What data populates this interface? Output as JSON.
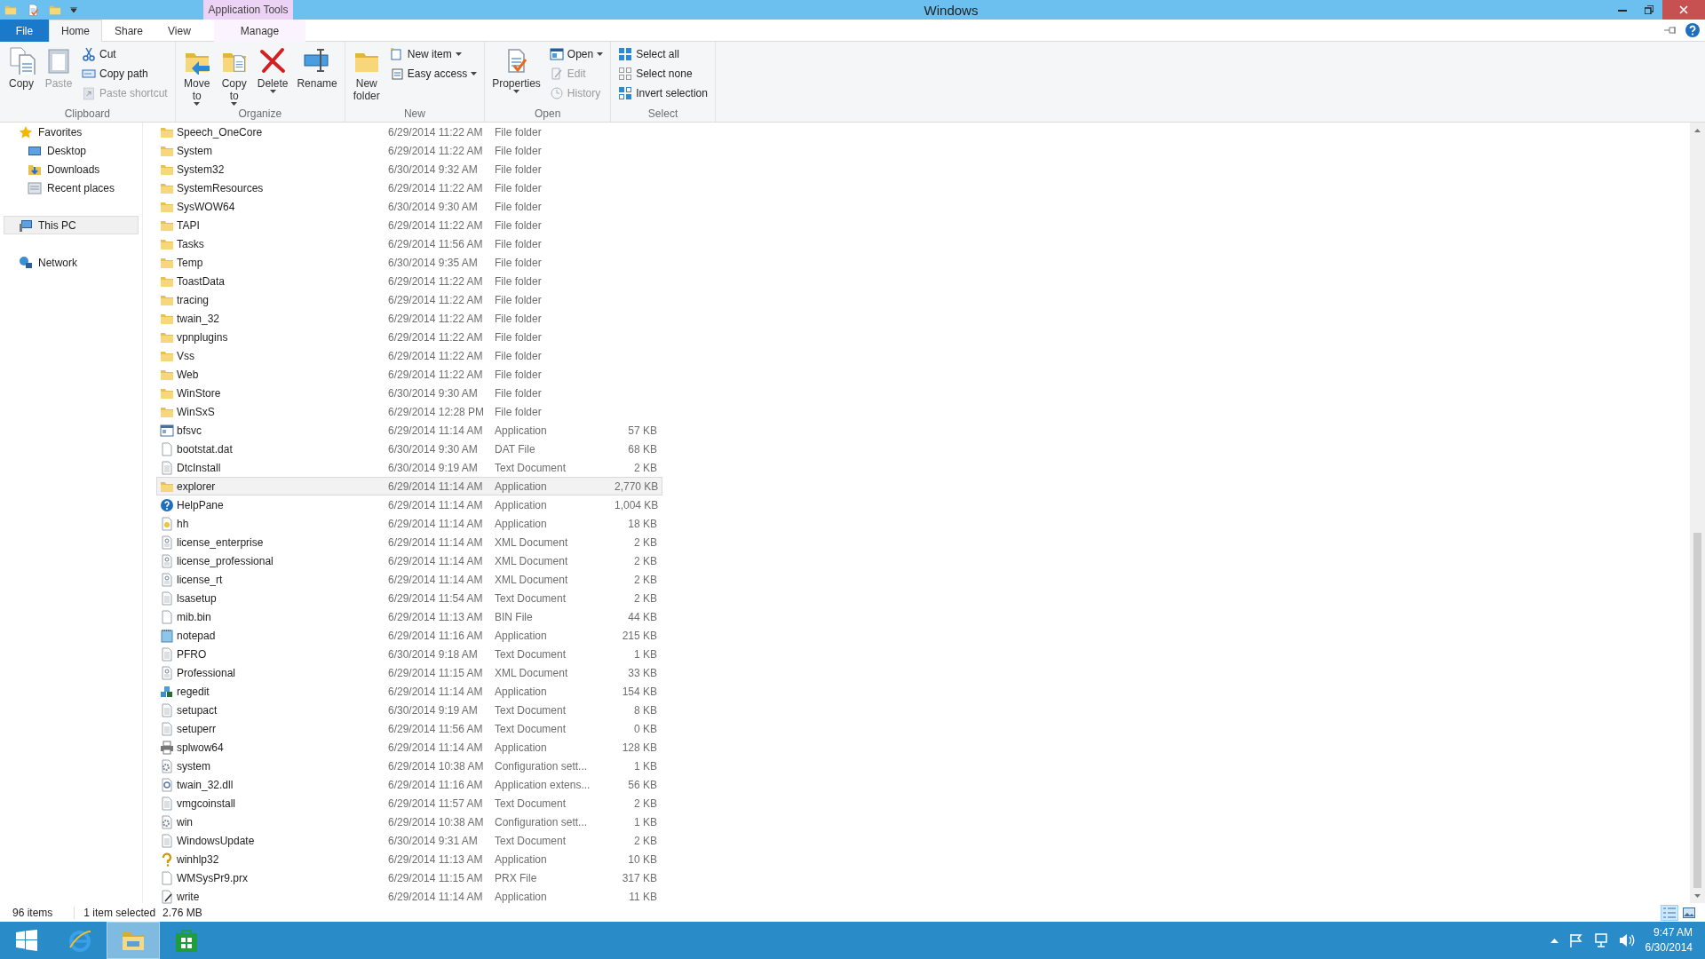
{
  "window": {
    "title": "Windows",
    "context_tab": "Application Tools"
  },
  "quick_access": [
    {
      "kind": "folder"
    },
    {
      "kind": "properties"
    },
    {
      "kind": "newfolder"
    },
    {
      "kind": "caret"
    }
  ],
  "tabs": [
    {
      "label": "File",
      "kind": "file",
      "selected": false
    },
    {
      "label": "Home",
      "kind": "tab",
      "selected": true
    },
    {
      "label": "Share",
      "kind": "tab",
      "selected": false
    },
    {
      "label": "View",
      "kind": "tab",
      "selected": false
    },
    {
      "label": "Manage",
      "kind": "context",
      "selected": false
    }
  ],
  "ribbon": [
    {
      "label": "Clipboard",
      "large_buttons": [
        {
          "lines": [
            "Copy"
          ],
          "kind": "copy",
          "disabled": false,
          "dropdown": false
        },
        {
          "lines": [
            "Paste"
          ],
          "kind": "paste",
          "disabled": true,
          "dropdown": false
        }
      ],
      "small_buttons": [
        {
          "label": "Cut",
          "kind": "cut",
          "disabled": false,
          "dropdown": false
        },
        {
          "label": "Copy path",
          "kind": "path",
          "disabled": false,
          "dropdown": false
        },
        {
          "label": "Paste shortcut",
          "kind": "shortcut",
          "disabled": true,
          "dropdown": false
        }
      ]
    },
    {
      "label": "Organize",
      "large_buttons": [
        {
          "lines": [
            "Move",
            "to"
          ],
          "kind": "move",
          "disabled": false,
          "dropdown": true
        },
        {
          "lines": [
            "Copy",
            "to"
          ],
          "kind": "copyto",
          "disabled": false,
          "dropdown": true
        },
        {
          "lines": [
            "Delete"
          ],
          "kind": "delete",
          "disabled": false,
          "dropdown": true
        },
        {
          "lines": [
            "Rename"
          ],
          "kind": "rename",
          "disabled": false,
          "dropdown": false
        }
      ]
    },
    {
      "label": "New",
      "large_buttons": [
        {
          "lines": [
            "New",
            "folder"
          ],
          "kind": "newfolder",
          "disabled": false,
          "dropdown": false
        }
      ],
      "small_buttons": [
        {
          "label": "New item",
          "kind": "newitem",
          "disabled": false,
          "dropdown": true
        },
        {
          "label": "Easy access",
          "kind": "easy",
          "disabled": false,
          "dropdown": true
        }
      ]
    },
    {
      "label": "Open",
      "large_buttons": [
        {
          "lines": [
            "Properties"
          ],
          "kind": "properties",
          "disabled": false,
          "dropdown": true
        }
      ],
      "small_buttons": [
        {
          "label": "Open",
          "kind": "open",
          "disabled": false,
          "dropdown": true
        },
        {
          "label": "Edit",
          "kind": "edit",
          "disabled": true,
          "dropdown": false
        },
        {
          "label": "History",
          "kind": "history",
          "disabled": true,
          "dropdown": false
        }
      ]
    },
    {
      "label": "Select",
      "small_buttons": [
        {
          "label": "Select all",
          "kind": "selall",
          "disabled": false,
          "dropdown": false
        },
        {
          "label": "Select none",
          "kind": "selnone",
          "disabled": false,
          "dropdown": false
        },
        {
          "label": "Invert selection",
          "kind": "invert",
          "disabled": false,
          "dropdown": false
        }
      ]
    }
  ],
  "navigation": [
    {
      "label": "Favorites",
      "kind": "star",
      "selected": false,
      "children": [
        {
          "label": "Desktop",
          "kind": "desktop",
          "selected": false
        },
        {
          "label": "Downloads",
          "kind": "downloads",
          "selected": false
        },
        {
          "label": "Recent places",
          "kind": "recent",
          "selected": false
        }
      ]
    },
    {
      "label": "This PC",
      "kind": "pc",
      "selected": true
    },
    {
      "label": "Network",
      "kind": "network",
      "selected": false
    }
  ],
  "files": [
    {
      "name": "Speech_OneCore",
      "date": "6/29/2014 11:22 AM",
      "type": "File folder",
      "kind": "folder",
      "selected": false
    },
    {
      "name": "System",
      "date": "6/29/2014 11:22 AM",
      "type": "File folder",
      "kind": "folder",
      "selected": false
    },
    {
      "name": "System32",
      "date": "6/30/2014 9:32 AM",
      "type": "File folder",
      "kind": "folder",
      "selected": false
    },
    {
      "name": "SystemResources",
      "date": "6/29/2014 11:22 AM",
      "type": "File folder",
      "kind": "folder",
      "selected": false
    },
    {
      "name": "SysWOW64",
      "date": "6/30/2014 9:30 AM",
      "type": "File folder",
      "kind": "folder",
      "selected": false
    },
    {
      "name": "TAPI",
      "date": "6/29/2014 11:22 AM",
      "type": "File folder",
      "kind": "folder",
      "selected": false
    },
    {
      "name": "Tasks",
      "date": "6/29/2014 11:56 AM",
      "type": "File folder",
      "kind": "folder",
      "selected": false
    },
    {
      "name": "Temp",
      "date": "6/30/2014 9:35 AM",
      "type": "File folder",
      "kind": "folder",
      "selected": false
    },
    {
      "name": "ToastData",
      "date": "6/29/2014 11:22 AM",
      "type": "File folder",
      "kind": "folder",
      "selected": false
    },
    {
      "name": "tracing",
      "date": "6/29/2014 11:22 AM",
      "type": "File folder",
      "kind": "folder",
      "selected": false
    },
    {
      "name": "twain_32",
      "date": "6/29/2014 11:22 AM",
      "type": "File folder",
      "kind": "folder",
      "selected": false
    },
    {
      "name": "vpnplugins",
      "date": "6/29/2014 11:22 AM",
      "type": "File folder",
      "kind": "folder",
      "selected": false
    },
    {
      "name": "Vss",
      "date": "6/29/2014 11:22 AM",
      "type": "File folder",
      "kind": "folder",
      "selected": false
    },
    {
      "name": "Web",
      "date": "6/29/2014 11:22 AM",
      "type": "File folder",
      "kind": "folder",
      "selected": false
    },
    {
      "name": "WinStore",
      "date": "6/30/2014 9:30 AM",
      "type": "File folder",
      "kind": "folder",
      "selected": false
    },
    {
      "name": "WinSxS",
      "date": "6/29/2014 12:28 PM",
      "type": "File folder",
      "kind": "folder",
      "selected": false
    },
    {
      "name": "bfsvc",
      "date": "6/29/2014 11:14 AM",
      "type": "Application",
      "size": "57 KB",
      "kind": "window",
      "selected": false
    },
    {
      "name": "bootstat.dat",
      "date": "6/30/2014 9:30 AM",
      "type": "DAT File",
      "size": "68 KB",
      "kind": "blank",
      "selected": false
    },
    {
      "name": "DtcInstall",
      "date": "6/30/2014 9:19 AM",
      "type": "Text Document",
      "size": "2 KB",
      "kind": "text",
      "selected": false
    },
    {
      "name": "explorer",
      "date": "6/29/2014 11:14 AM",
      "type": "Application",
      "size": "2,770 KB",
      "kind": "explorer",
      "selected": true
    },
    {
      "name": "HelpPane",
      "date": "6/29/2014 11:14 AM",
      "type": "Application",
      "size": "1,004 KB",
      "kind": "help",
      "selected": false
    },
    {
      "name": "hh",
      "date": "6/29/2014 11:14 AM",
      "type": "Application",
      "size": "18 KB",
      "kind": "helpdoc",
      "selected": false
    },
    {
      "name": "license_enterprise",
      "date": "6/29/2014 11:14 AM",
      "type": "XML Document",
      "size": "2 KB",
      "kind": "xml",
      "selected": false
    },
    {
      "name": "license_professional",
      "date": "6/29/2014 11:14 AM",
      "type": "XML Document",
      "size": "2 KB",
      "kind": "xml",
      "selected": false
    },
    {
      "name": "license_rt",
      "date": "6/29/2014 11:14 AM",
      "type": "XML Document",
      "size": "2 KB",
      "kind": "xml",
      "selected": false
    },
    {
      "name": "lsasetup",
      "date": "6/29/2014 11:54 AM",
      "type": "Text Document",
      "size": "2 KB",
      "kind": "text",
      "selected": false
    },
    {
      "name": "mib.bin",
      "date": "6/29/2014 11:13 AM",
      "type": "BIN File",
      "size": "44 KB",
      "kind": "blank",
      "selected": false
    },
    {
      "name": "notepad",
      "date": "6/29/2014 11:16 AM",
      "type": "Application",
      "size": "215 KB",
      "kind": "notepad",
      "selected": false
    },
    {
      "name": "PFRO",
      "date": "6/30/2014 9:18 AM",
      "type": "Text Document",
      "size": "1 KB",
      "kind": "text",
      "selected": false
    },
    {
      "name": "Professional",
      "date": "6/29/2014 11:15 AM",
      "type": "XML Document",
      "size": "33 KB",
      "kind": "xml",
      "selected": false
    },
    {
      "name": "regedit",
      "date": "6/29/2014 11:14 AM",
      "type": "Application",
      "size": "154 KB",
      "kind": "cubes",
      "selected": false
    },
    {
      "name": "setupact",
      "date": "6/30/2014 9:19 AM",
      "type": "Text Document",
      "size": "8 KB",
      "kind": "text",
      "selected": false
    },
    {
      "name": "setuperr",
      "date": "6/29/2014 11:56 AM",
      "type": "Text Document",
      "size": "0 KB",
      "kind": "text",
      "selected": false
    },
    {
      "name": "splwow64",
      "date": "6/29/2014 11:14 AM",
      "type": "Application",
      "size": "128 KB",
      "kind": "printer",
      "selected": false
    },
    {
      "name": "system",
      "date": "6/29/2014 10:38 AM",
      "type": "Configuration sett...",
      "size": "1 KB",
      "kind": "config",
      "selected": false
    },
    {
      "name": "twain_32.dll",
      "date": "6/29/2014 11:16 AM",
      "type": "Application extens...",
      "size": "56 KB",
      "kind": "dll",
      "selected": false
    },
    {
      "name": "vmgcoinstall",
      "date": "6/29/2014 11:57 AM",
      "type": "Text Document",
      "size": "2 KB",
      "kind": "text",
      "selected": false
    },
    {
      "name": "win",
      "date": "6/29/2014 10:38 AM",
      "type": "Configuration sett...",
      "size": "1 KB",
      "kind": "config",
      "selected": false
    },
    {
      "name": "WindowsUpdate",
      "date": "6/30/2014 9:31 AM",
      "type": "Text Document",
      "size": "2 KB",
      "kind": "text",
      "selected": false
    },
    {
      "name": "winhlp32",
      "date": "6/29/2014 11:13 AM",
      "type": "Application",
      "size": "10 KB",
      "kind": "question",
      "selected": false
    },
    {
      "name": "WMSysPr9.prx",
      "date": "6/29/2014 11:15 AM",
      "type": "PRX File",
      "size": "317 KB",
      "kind": "blank",
      "selected": false
    },
    {
      "name": "write",
      "date": "6/29/2014 11:14 AM",
      "type": "Application",
      "size": "11 KB",
      "kind": "write",
      "selected": false
    }
  ],
  "status_bar": {
    "count": "96 items",
    "selection": "1 item selected",
    "size": "2.76 MB",
    "views": [
      {
        "kind": "details",
        "selected": true
      },
      {
        "kind": "thumbnails",
        "selected": false
      }
    ]
  },
  "taskbar": {
    "apps": [
      {
        "kind": "browser",
        "selected": false
      },
      {
        "kind": "explorer",
        "selected": true
      },
      {
        "kind": "store",
        "selected": false
      }
    ],
    "time": "9:47 AM",
    "date": "6/30/2014"
  }
}
